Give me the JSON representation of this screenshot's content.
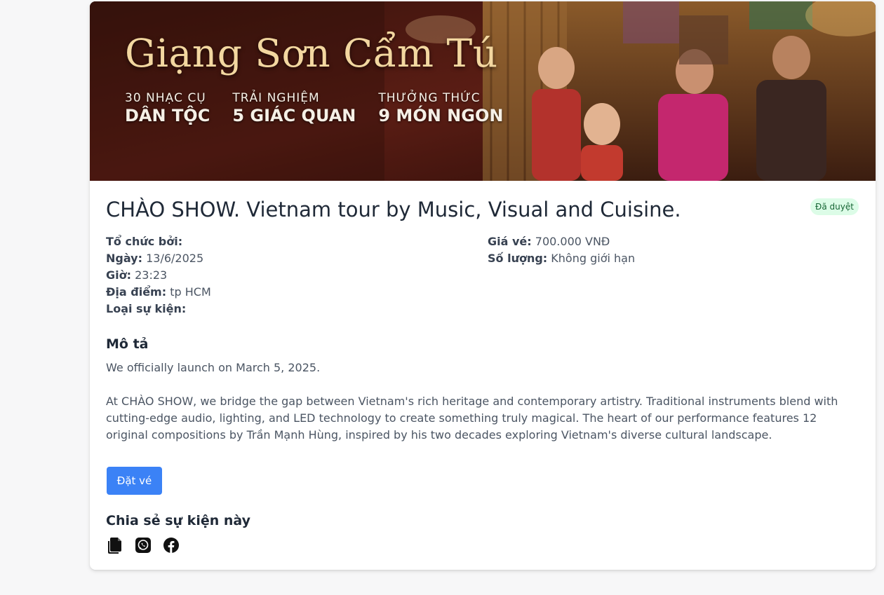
{
  "banner": {
    "title": "Giạng Sơn Cẩm Tú",
    "features": [
      {
        "top": "30 NHẠC CỤ",
        "bottom": "DÂN TỘC"
      },
      {
        "top": "TRẢI NGHIỆM",
        "bottom": "5 GIÁC QUAN"
      },
      {
        "top": "THƯỞNG THỨC",
        "bottom": "9 MÓN NGON"
      }
    ]
  },
  "event": {
    "title": "CHÀO SHOW. Vietnam tour by Music, Visual and Cuisine.",
    "status": "Đã duyệt",
    "organizer_label": "Tổ chức bởi:",
    "organizer_value": "",
    "date_label": "Ngày:",
    "date_value": "13/6/2025",
    "time_label": "Giờ:",
    "time_value": "23:23",
    "location_label": "Địa điểm:",
    "location_value": "tp HCM",
    "type_label": "Loại sự kiện:",
    "type_value": "",
    "price_label": "Giá vé:",
    "price_value": "700.000 VNĐ",
    "quantity_label": "Số lượng:",
    "quantity_value": "Không giới hạn"
  },
  "description": {
    "heading": "Mô tả",
    "paragraphs": [
      "We officially launch on March 5, 2025.",
      "At CHÀO SHOW, we bridge the gap between Vietnam's rich heritage and contemporary artistry. Traditional instruments blend with cutting-edge audio, lighting, and LED technology to create something truly magical. The heart of our performance features 12 original compositions by Trần Mạnh Hùng, inspired by his two decades exploring Vietnam's diverse cultural landscape."
    ]
  },
  "actions": {
    "book_label": "Đặt vé"
  },
  "share": {
    "heading": "Chia sẻ sự kiện này",
    "icons": [
      "copy-icon",
      "whatsapp-icon",
      "facebook-icon"
    ]
  },
  "colors": {
    "primary_button": "#3b82f6",
    "badge_bg": "#dcfce7",
    "badge_text": "#166534",
    "banner_title": "#f3d7a0"
  }
}
